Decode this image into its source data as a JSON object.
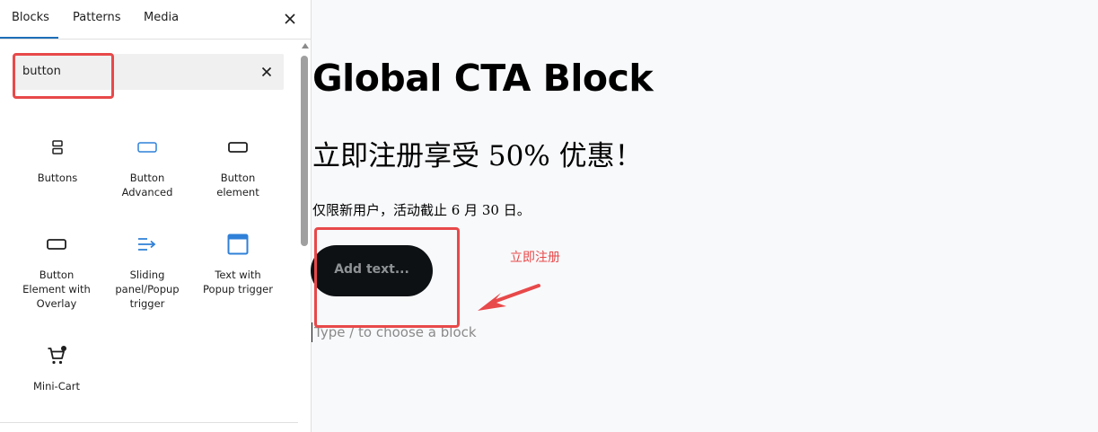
{
  "inserter": {
    "tabs": [
      {
        "label": "Blocks"
      },
      {
        "label": "Patterns"
      },
      {
        "label": "Media"
      }
    ],
    "active_tab": "Blocks",
    "search": {
      "value": "button"
    },
    "blocks": [
      {
        "label": "Buttons",
        "icon": "buttons-icon"
      },
      {
        "label": "Button\nAdvanced",
        "icon": "button-advanced-icon"
      },
      {
        "label": "Button\nelement",
        "icon": "button-element-icon"
      },
      {
        "label": "Button\nElement with\nOverlay",
        "icon": "button-overlay-icon"
      },
      {
        "label": "Sliding\npanel/Popup\ntrigger",
        "icon": "sliding-panel-icon"
      },
      {
        "label": "Text with\nPopup trigger",
        "icon": "text-popup-icon"
      },
      {
        "label": "Mini-Cart",
        "icon": "cart-icon"
      }
    ]
  },
  "editor": {
    "heading": "Global CTA Block",
    "subheading": "立即注册享受 50% 优惠！",
    "paragraph": "仅限新用户，活动截止 6 月 30 日。",
    "button_label": "Add text...",
    "placeholder": "Type / to choose a block"
  },
  "annotation": {
    "text": "立即注册",
    "color": "#e8494a"
  },
  "colors": {
    "accent_blue": "#1e6fb8",
    "icon_blue": "#2f80d8",
    "button_bg": "#0e1114"
  }
}
